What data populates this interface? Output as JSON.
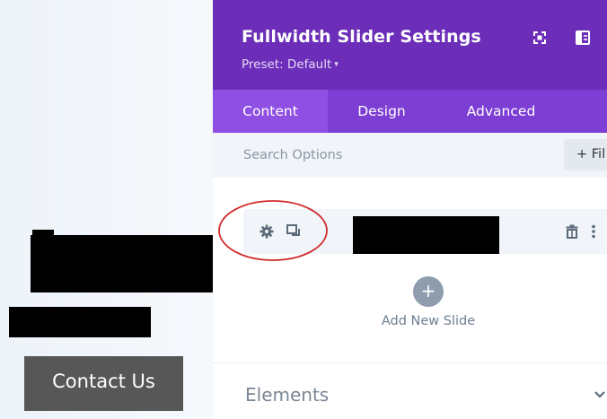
{
  "page": {
    "contact_button_label": "Contact Us"
  },
  "panel": {
    "title": "Fullwidth Slider Settings",
    "preset_label": "Preset: Default",
    "preset_caret": "▾",
    "header_icons": [
      "fullscreen-icon",
      "split-view-icon"
    ],
    "tabs": [
      {
        "label": "Content",
        "active": true
      },
      {
        "label": "Design",
        "active": false
      },
      {
        "label": "Advanced",
        "active": false
      }
    ],
    "search": {
      "placeholder": "Search Options",
      "filter_label": "+ Fil"
    },
    "slides": [
      {
        "icons": [
          "gear-icon",
          "duplicate-icon",
          "trash-icon",
          "more-vertical-icon"
        ],
        "label_redacted": true
      }
    ],
    "add_slide": {
      "icon": "+",
      "label": "Add New Slide"
    },
    "elements_section": {
      "label": "Elements",
      "icon": "chevron-down-icon"
    }
  },
  "colors": {
    "header_bg": "#6c2eb9",
    "tabs_bg": "#7d3fd3",
    "active_tab_bg": "#8f4fe2",
    "search_bg": "#f1f4f8",
    "contact_button_bg": "#575757",
    "annotation_circle": "#d22b2b"
  }
}
